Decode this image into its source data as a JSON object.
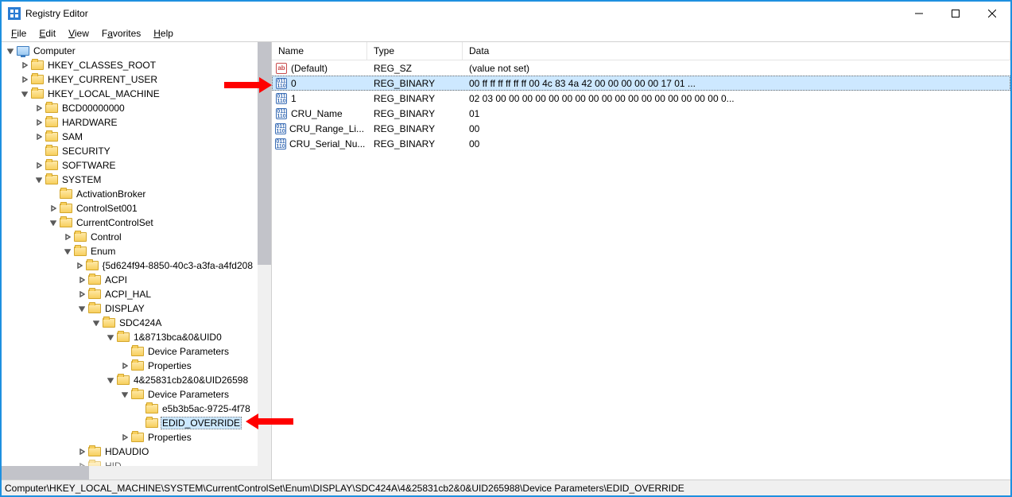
{
  "window": {
    "title": "Registry Editor"
  },
  "menu": {
    "file": "File",
    "edit": "Edit",
    "view": "View",
    "favorites": "Favorites",
    "help": "Help"
  },
  "tree": {
    "computer": "Computer",
    "hkcr": "HKEY_CLASSES_ROOT",
    "hkcu": "HKEY_CURRENT_USER",
    "hklm": "HKEY_LOCAL_MACHINE",
    "bcd": "BCD00000000",
    "hardware": "HARDWARE",
    "sam": "SAM",
    "security": "SECURITY",
    "software": "SOFTWARE",
    "system": "SYSTEM",
    "activationbroker": "ActivationBroker",
    "controlset001": "ControlSet001",
    "currentcontrolset": "CurrentControlSet",
    "control": "Control",
    "enum": "Enum",
    "guid1": "{5d624f94-8850-40c3-a3fa-a4fd208",
    "acpi": "ACPI",
    "acpihal": "ACPI_HAL",
    "display": "DISPLAY",
    "sdc424a": "SDC424A",
    "uid0": "1&8713bca&0&UID0",
    "devparams1": "Device Parameters",
    "properties1": "Properties",
    "uid265988": "4&25831cb2&0&UID26598",
    "devparams2": "Device Parameters",
    "e5b": "e5b3b5ac-9725-4f78",
    "edid": "EDID_OVERRIDE",
    "properties2": "Properties",
    "hdaudio": "HDAUDIO",
    "hid": "HID"
  },
  "columns": {
    "name": "Name",
    "type": "Type",
    "data": "Data"
  },
  "values": [
    {
      "icon": "sz",
      "name": "(Default)",
      "type": "REG_SZ",
      "data": "(value not set)"
    },
    {
      "icon": "bin",
      "name": "0",
      "type": "REG_BINARY",
      "data": "00 ff ff ff ff ff ff 00 4c 83 4a 42 00 00 00 00 00 17 01 ...",
      "selected": true
    },
    {
      "icon": "bin",
      "name": "1",
      "type": "REG_BINARY",
      "data": "02 03 00 00 00 00 00 00 00 00 00 00 00 00 00 00 00 00 00 0..."
    },
    {
      "icon": "bin",
      "name": "CRU_Name",
      "type": "REG_BINARY",
      "data": "01"
    },
    {
      "icon": "bin",
      "name": "CRU_Range_Li...",
      "type": "REG_BINARY",
      "data": "00"
    },
    {
      "icon": "bin",
      "name": "CRU_Serial_Nu...",
      "type": "REG_BINARY",
      "data": "00"
    }
  ],
  "statusbar": "Computer\\HKEY_LOCAL_MACHINE\\SYSTEM\\CurrentControlSet\\Enum\\DISPLAY\\SDC424A\\4&25831cb2&0&UID265988\\Device Parameters\\EDID_OVERRIDE"
}
